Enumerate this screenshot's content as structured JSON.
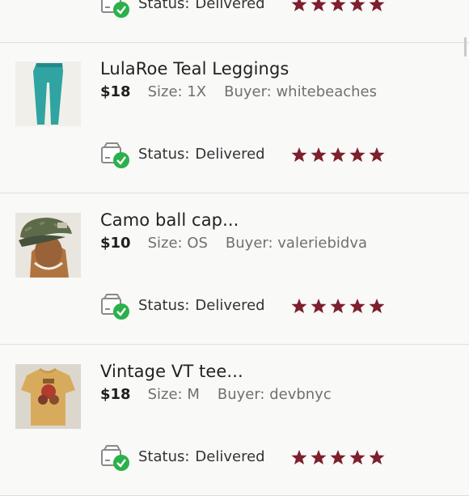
{
  "orders": [
    {
      "title": "",
      "price": "",
      "size": "",
      "buyer": "",
      "status_label": "Status:",
      "status_value": "Delivered",
      "rating": 5,
      "thumb": "none"
    },
    {
      "title": "LulaRoe Teal Leggings",
      "price": "$18",
      "size": "Size: 1X",
      "buyer": "Buyer: whitebeaches",
      "status_label": "Status:",
      "status_value": "Delivered",
      "rating": 5,
      "thumb": "teal-leggings"
    },
    {
      "title": "Camo ball cap...",
      "price": "$10",
      "size": "Size: OS",
      "buyer": "Buyer: valeriebidva",
      "status_label": "Status:",
      "status_value": "Delivered",
      "rating": 5,
      "thumb": "camo-cap"
    },
    {
      "title": "Vintage VT tee...",
      "price": "$18",
      "size": "Size: M",
      "buyer": "Buyer: devbnyc",
      "status_label": "Status:",
      "status_value": "Delivered",
      "rating": 5,
      "thumb": "vintage-tee"
    }
  ],
  "colors": {
    "star": "#7d1f2c",
    "check": "#2bb04a",
    "divider": "#e0dedc"
  }
}
